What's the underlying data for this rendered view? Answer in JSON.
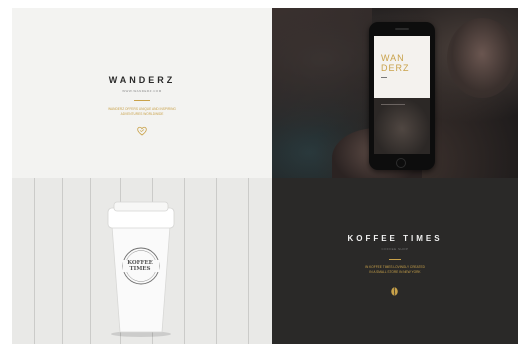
{
  "tiles": {
    "wanderz": {
      "brand": "WANDERZ",
      "subtitle": "WWW.WANDERZ.COM",
      "description_line1": "WANDERZ OFFERS UNIQUE AND INSPIRING",
      "description_line2": "ADVENTURES WORLDWIDE",
      "icon": "heart-icon"
    },
    "phone_photo": {
      "screen_title_line1": "WAN",
      "screen_title_line2": "DERZ"
    },
    "coffee_cup": {
      "label_line1": "KOFFEE",
      "label_line2": "TIMES"
    },
    "koffee_times": {
      "brand": "KOFFEE TIMES",
      "subtitle": "COFFEE SHOP",
      "description_line1": "IN KOFFEE TIMES LOVINGLY CREATED",
      "description_line2": "IN A SMALL STORE IN NEW YORK",
      "icon": "coffee-bean-icon"
    }
  },
  "colors": {
    "accent_gold": "#c9a24a",
    "dark_tile": "#2a2928",
    "light_tile": "#f3f3f1"
  }
}
